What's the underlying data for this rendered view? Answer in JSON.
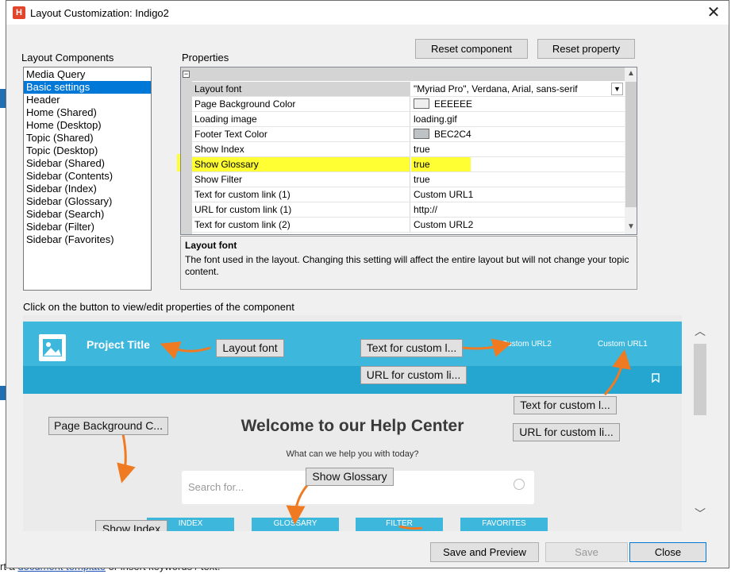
{
  "window": {
    "title": "Layout Customization: Indigo2",
    "close_glyph": "✕"
  },
  "buttons": {
    "reset_component": "Reset component",
    "reset_property": "Reset property",
    "save_preview": "Save and Preview",
    "save": "Save",
    "close": "Close"
  },
  "components": {
    "label": "Layout Components",
    "items": [
      "Media Query",
      "Basic settings",
      "Header",
      "Home (Shared)",
      "Home (Desktop)",
      "Topic (Shared)",
      "Topic (Desktop)",
      "Sidebar (Shared)",
      "Sidebar (Contents)",
      "Sidebar (Index)",
      "Sidebar (Glossary)",
      "Sidebar (Search)",
      "Sidebar (Filter)",
      "Sidebar (Favorites)"
    ],
    "selected": "Basic settings"
  },
  "properties": {
    "label": "Properties",
    "rows": [
      {
        "name": "Layout font",
        "value": "\"Myriad Pro\", Verdana, Arial, sans-serif"
      },
      {
        "name": "Page Background Color",
        "value": "EEEEEE",
        "swatch": "#eeeeee"
      },
      {
        "name": "Loading image",
        "value": "loading.gif"
      },
      {
        "name": "Footer Text Color",
        "value": "BEC2C4",
        "swatch": "#bec2c4"
      },
      {
        "name": "Show Index",
        "value": "true"
      },
      {
        "name": "Show Glossary",
        "value": "true"
      },
      {
        "name": "Show Filter",
        "value": "true"
      },
      {
        "name": "Text for custom link (1)",
        "value": "Custom URL1"
      },
      {
        "name": "URL for custom link (1)",
        "value": "http://"
      },
      {
        "name": "Text for custom link (2)",
        "value": "Custom URL2"
      }
    ]
  },
  "description": {
    "title": "Layout font",
    "body": "The font used in the layout. Changing this setting will affect the entire layout but will not change your topic content."
  },
  "preview": {
    "instruction": "Click on the button to view/edit properties of the component",
    "project_title": "Project Title",
    "custom_url2": "Custom URL2",
    "custom_url1": "Custom URL1",
    "welcome": "Welcome to our Help Center",
    "subtitle": "What can we help you with today?",
    "search_placeholder": "Search for...",
    "tabs": [
      "INDEX",
      "GLOSSARY",
      "FILTER",
      "FAVORITES"
    ],
    "callouts": {
      "layout_font": "Layout font",
      "text_custom_link_1": "Text for custom l...",
      "url_custom_link_1": "URL for custom li...",
      "text_custom_link_2": "Text for custom l...",
      "url_custom_link_2": "URL for custom li...",
      "page_background": "Page Background C...",
      "show_glossary": "Show Glossary",
      "show_index": "Show Index"
    }
  },
  "background": {
    "bottom_prefix": "rt a ",
    "bottom_link": "document template",
    "bottom_suffix": " or insert keywords / text."
  },
  "colors": {
    "accent": "#0078d7",
    "preview_header": "#3eb7dd",
    "preview_nav": "#24a6d0",
    "arrow": "#f07a22",
    "highlight": "#ffff33"
  },
  "icons": [
    "app-icon",
    "close-icon",
    "image-icon",
    "bookmark-icon",
    "search-icon",
    "scroll-up-icon",
    "scroll-down-icon",
    "dropdown-icon"
  ]
}
